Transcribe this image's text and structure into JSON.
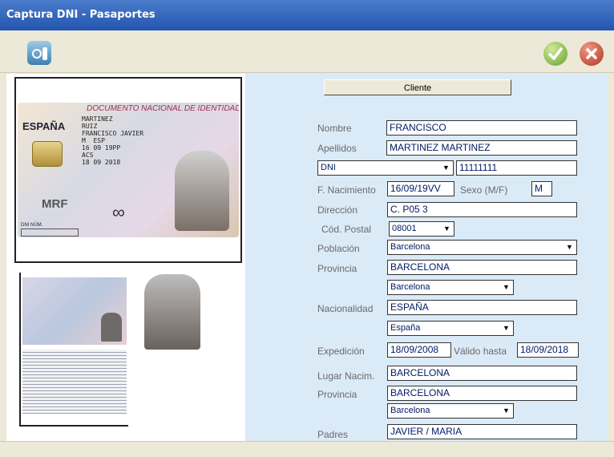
{
  "window": {
    "title": "Captura DNI - Pasaportes"
  },
  "toolbar": {
    "left_icon": "scan-id-icon",
    "ok_icon": "check-icon",
    "cancel_icon": "close-icon"
  },
  "card": {
    "header": "DOCUMENTO NACIONAL DE IDENTIDAD",
    "country": "ESPAÑA",
    "text": "MARTINEZ\nRUIZ\nFRANCISCO JAVIER\nM  ESP\n16 09 19PP\nACS\n18 09 2018",
    "mark": "MRF",
    "num_label": "DNI NÚM."
  },
  "form": {
    "cliente_button": "Cliente",
    "nombre_label": "Nombre",
    "nombre": "FRANCISCO",
    "apellidos_label": "Apellidos",
    "apellidos": "MARTINEZ MARTINEZ",
    "doc_type": "DNI",
    "doc_number": "11111111",
    "nacimiento_label": "F. Nacimiento",
    "nacimiento": "16/09/19VV",
    "sexo_label": "Sexo (M/F)",
    "sexo": "M",
    "direccion_label": "Dirección",
    "direccion": "C. P05 3",
    "cp_label": "Cód. Postal",
    "cp": "08001",
    "poblacion_label": "Población",
    "poblacion": "Barcelona",
    "provincia_label": "Provincia",
    "provincia": "BARCELONA",
    "provincia_select": "Barcelona",
    "nacionalidad_label": "Nacionalidad",
    "nacionalidad": "ESPAÑA",
    "nacionalidad_select": "España",
    "expedicion_label": "Expedición",
    "expedicion": "18/09/2008",
    "valido_label": "Válido hasta",
    "valido": "18/09/2018",
    "lugar_label": "Lugar Nacim.",
    "lugar": "BARCELONA",
    "provincia2_label": "Provincia",
    "provincia2": "BARCELONA",
    "provincia2_select": "Barcelona",
    "padres_label": "Padres",
    "padres": "JAVIER / MARIA"
  }
}
